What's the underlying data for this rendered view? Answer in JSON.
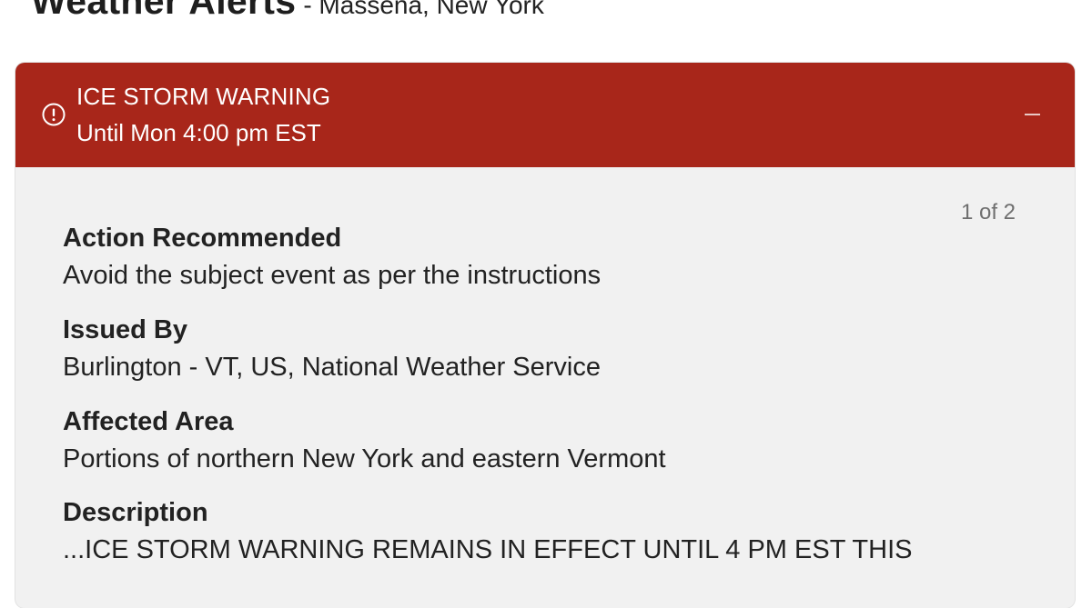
{
  "header": {
    "title": "Weather Alerts",
    "location": "- Massena, New York"
  },
  "alert": {
    "title": "ICE STORM WARNING",
    "until": "Until Mon 4:00 pm EST",
    "icon": "alert-circle-icon",
    "color": "#a8261a",
    "pager": "1 of 2",
    "fields": [
      {
        "label": "Action Recommended",
        "value": "Avoid the subject event as per the instructions"
      },
      {
        "label": "Issued By",
        "value": "Burlington - VT, US, National Weather Service"
      },
      {
        "label": "Affected Area",
        "value": "Portions of northern New York and eastern Vermont"
      },
      {
        "label": "Description",
        "value": "...ICE STORM WARNING REMAINS IN EFFECT UNTIL 4 PM EST THIS"
      }
    ]
  }
}
